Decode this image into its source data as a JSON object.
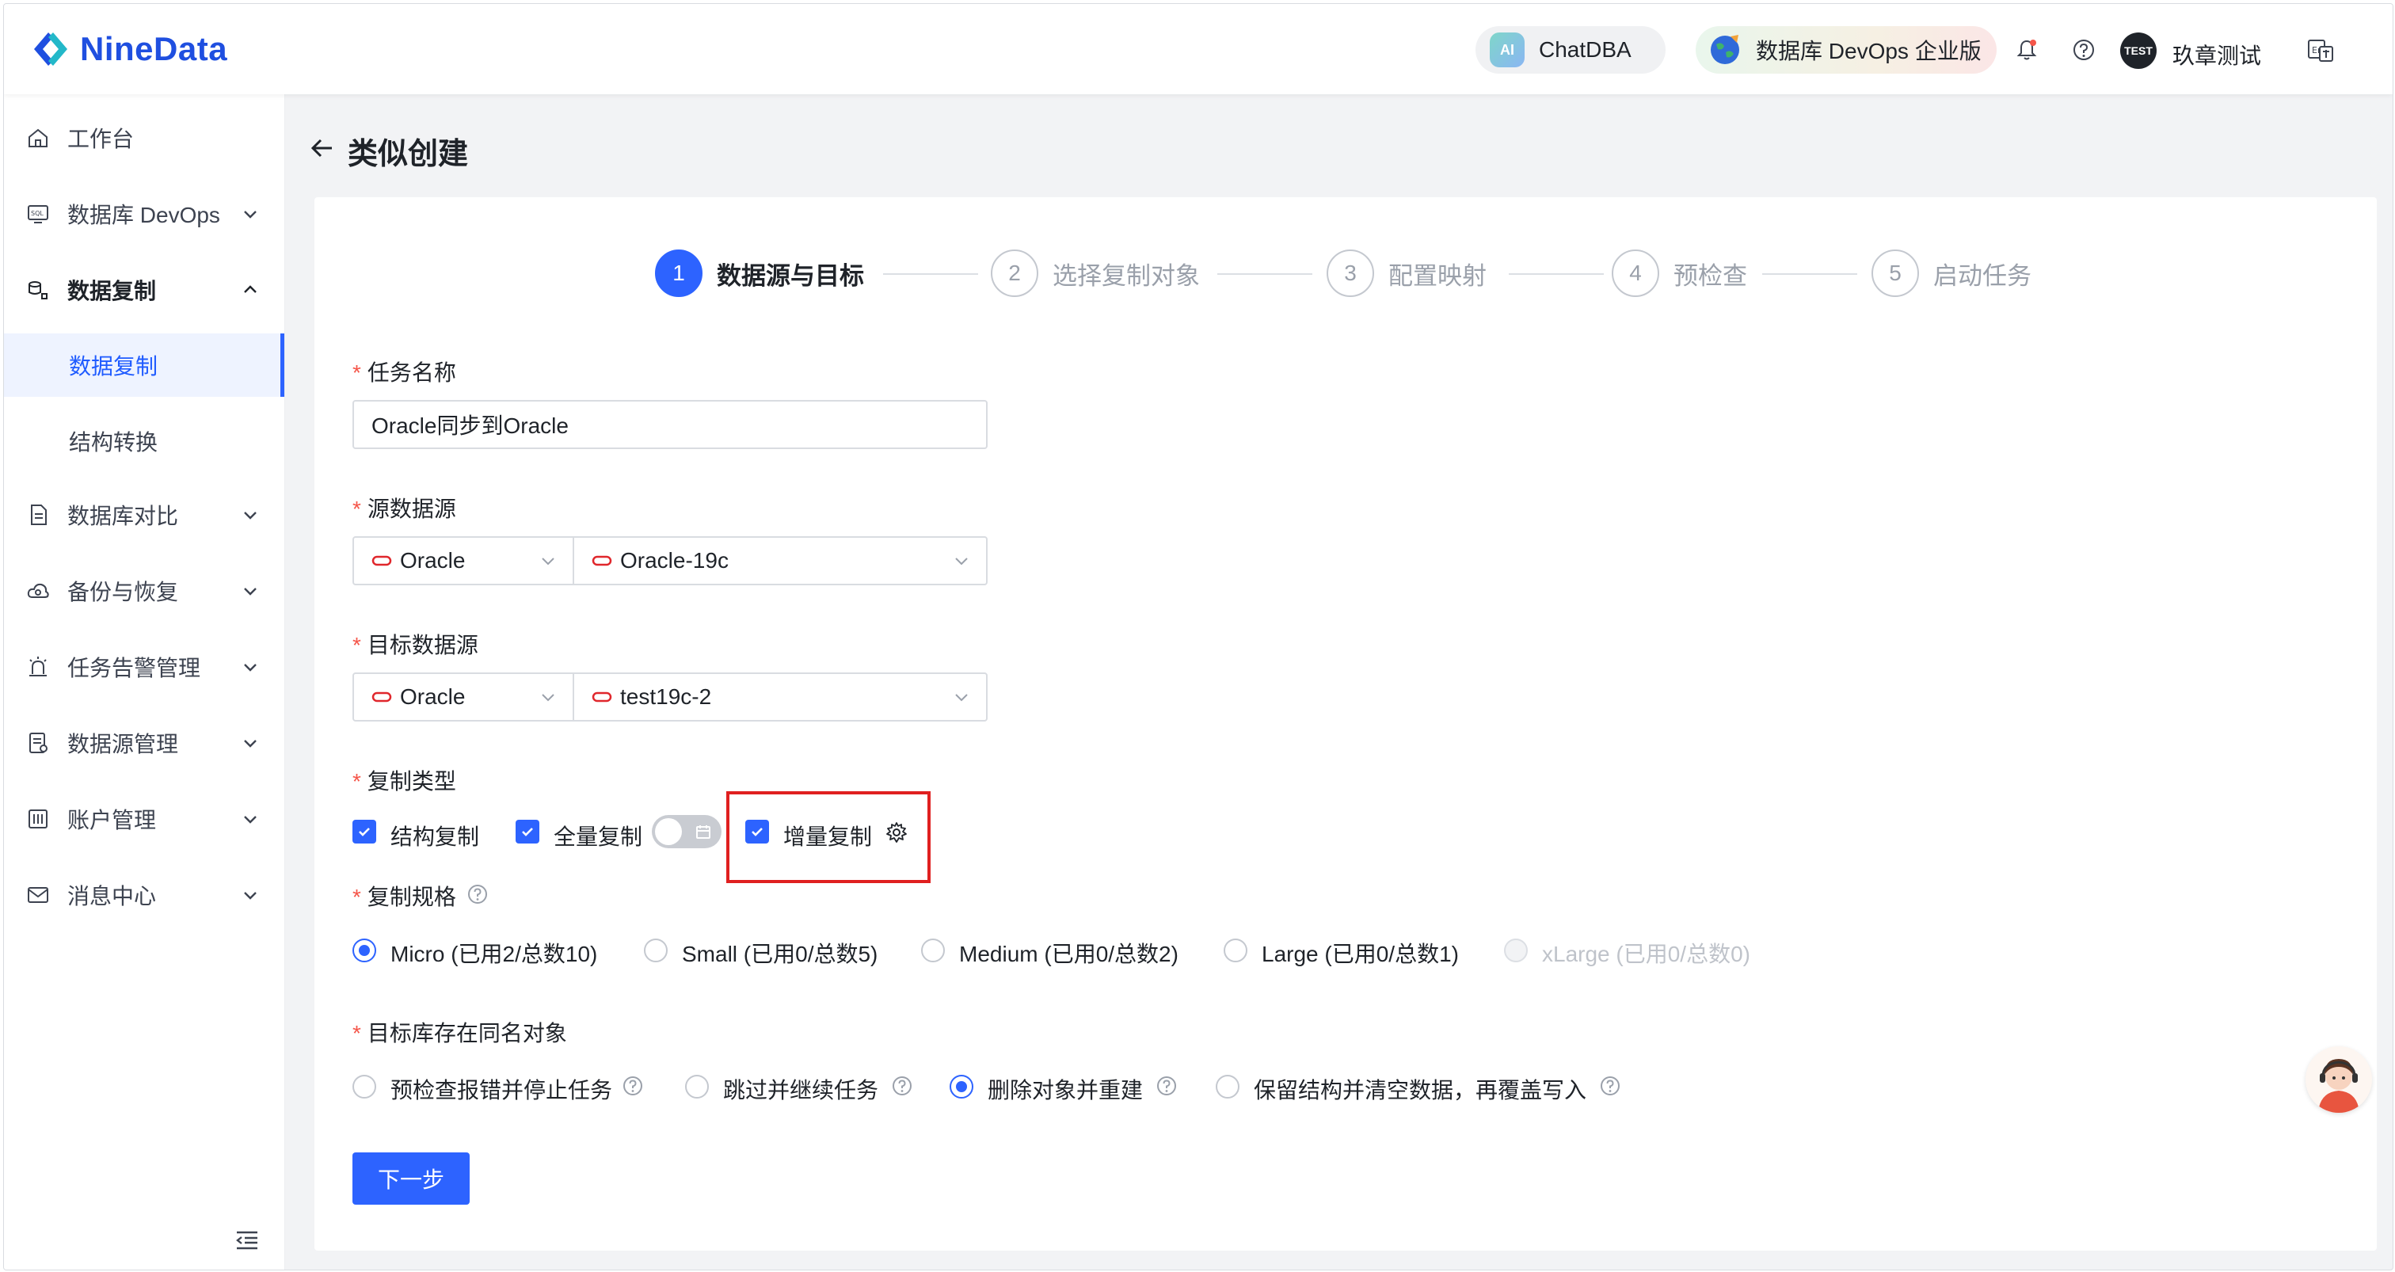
{
  "app": {
    "logo_text": "NineData"
  },
  "header": {
    "chatdba_label": "ChatDBA",
    "chatdba_badge": "AI",
    "edition_label": "数据库 DevOps 企业版",
    "avatar_text": "TEST",
    "username": "玖章测试"
  },
  "sidebar": {
    "items": [
      {
        "label": "工作台",
        "icon": "home-icon"
      },
      {
        "label": "数据库 DevOps",
        "icon": "sql-icon"
      },
      {
        "label": "数据复制",
        "icon": "replication-icon"
      },
      {
        "label": "数据库对比",
        "icon": "compare-icon"
      },
      {
        "label": "备份与恢复",
        "icon": "cloud-backup-icon"
      },
      {
        "label": "任务告警管理",
        "icon": "alarm-icon"
      },
      {
        "label": "数据源管理",
        "icon": "datasource-icon"
      },
      {
        "label": "账户管理",
        "icon": "account-icon"
      },
      {
        "label": "消息中心",
        "icon": "mail-icon"
      }
    ],
    "subitems": [
      {
        "label": "数据复制",
        "active": true
      },
      {
        "label": "结构转换",
        "active": false
      }
    ]
  },
  "page": {
    "title": "类似创建"
  },
  "steps": [
    {
      "number": "1",
      "label": "数据源与目标",
      "active": true
    },
    {
      "number": "2",
      "label": "选择复制对象",
      "active": false
    },
    {
      "number": "3",
      "label": "配置映射",
      "active": false
    },
    {
      "number": "4",
      "label": "预检查",
      "active": false
    },
    {
      "number": "5",
      "label": "启动任务",
      "active": false
    }
  ],
  "form": {
    "required_mark": "*",
    "task_name": {
      "label": "任务名称",
      "value": "Oracle同步到Oracle"
    },
    "source": {
      "label": "源数据源",
      "type": "Oracle",
      "instance": "Oracle-19c"
    },
    "target": {
      "label": "目标数据源",
      "type": "Oracle",
      "instance": "test19c-2"
    },
    "replication_type": {
      "label": "复制类型",
      "options": [
        {
          "label": "结构复制",
          "checked": true
        },
        {
          "label": "全量复制",
          "checked": true
        },
        {
          "label": "增量复制",
          "checked": true
        }
      ],
      "schedule_toggle_on": false
    },
    "spec": {
      "label": "复制规格",
      "options": [
        {
          "label": "Micro (已用2/总数10)",
          "checked": true,
          "disabled": false
        },
        {
          "label": "Small (已用0/总数5)",
          "checked": false,
          "disabled": false
        },
        {
          "label": "Medium (已用0/总数2)",
          "checked": false,
          "disabled": false
        },
        {
          "label": "Large (已用0/总数1)",
          "checked": false,
          "disabled": false
        },
        {
          "label": "xLarge (已用0/总数0)",
          "checked": false,
          "disabled": true
        }
      ]
    },
    "conflict": {
      "label": "目标库存在同名对象",
      "options": [
        {
          "label": "预检查报错并停止任务",
          "checked": false
        },
        {
          "label": "跳过并继续任务",
          "checked": false
        },
        {
          "label": "删除对象并重建",
          "checked": true
        },
        {
          "label": "保留结构并清空数据，再覆盖写入",
          "checked": false
        }
      ]
    },
    "next_button": "下一步"
  },
  "colors": {
    "primary": "#2d63ff",
    "highlight": "#e02020",
    "oracle": "#e0272c",
    "required": "#f5564a"
  }
}
